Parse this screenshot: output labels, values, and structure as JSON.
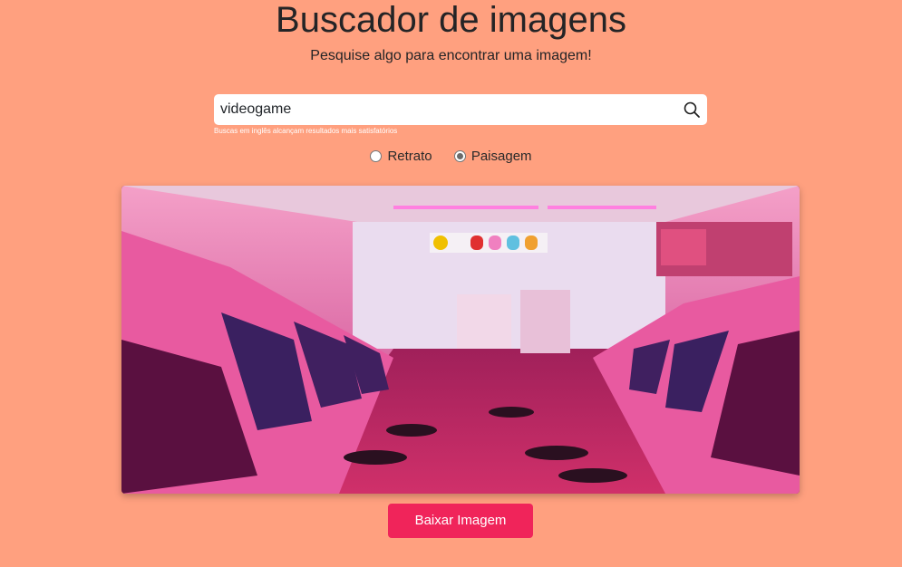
{
  "header": {
    "title": "Buscador de imagens",
    "subtitle": "Pesquise algo para encontrar uma imagem!"
  },
  "search": {
    "value": "videogame",
    "hint": "Buscas em inglês alcançam resultados mais satisfatórios",
    "icon": "search-icon"
  },
  "orientation": {
    "options": [
      {
        "label": "Retrato",
        "checked": false
      },
      {
        "label": "Paisagem",
        "checked": true
      }
    ]
  },
  "result": {
    "description": "arcade room photo"
  },
  "actions": {
    "download_label": "Baixar Imagem"
  },
  "colors": {
    "background": "#ffa07f",
    "button": "#f0245a"
  }
}
